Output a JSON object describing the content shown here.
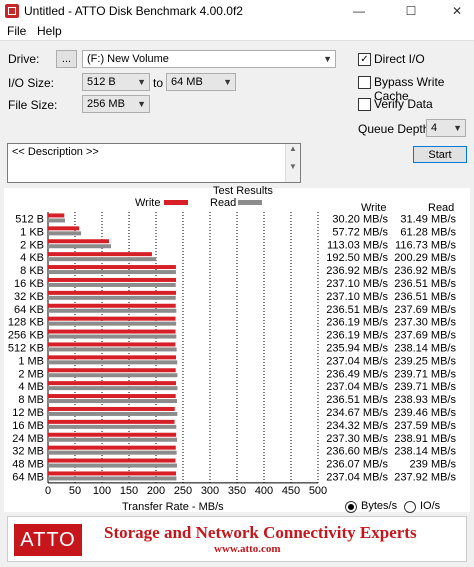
{
  "window": {
    "title": "Untitled - ATTO Disk Benchmark 4.00.0f2",
    "minimize": "—",
    "maximize": "☐",
    "close": "✕"
  },
  "menu": {
    "file": "File",
    "help": "Help"
  },
  "controls": {
    "drive_label": "Drive:",
    "browse_label": "...",
    "drive_value": "(F:) New Volume",
    "io_size_label": "I/O Size:",
    "io_from": "512 B",
    "to_label": "to",
    "io_to": "64 MB",
    "file_size_label": "File Size:",
    "file_size": "256 MB",
    "direct_io_label": "Direct I/O",
    "direct_io_checked": true,
    "bypass_label": "Bypass Write Cache",
    "bypass_checked": false,
    "verify_label": "Verify Data",
    "verify_checked": false,
    "queue_depth_label": "Queue Depth:",
    "queue_depth": "4",
    "start_label": "Start",
    "description": "<< Description >>"
  },
  "results": {
    "heading": "Test Results",
    "legend_write": "Write",
    "legend_read": "Read",
    "col_write": "Write",
    "col_read": "Read",
    "xlabel": "Transfer Rate - MB/s",
    "unit_bytes": "Bytes/s",
    "unit_io": "IO/s",
    "unit_selected": "Bytes/s"
  },
  "chart_data": {
    "type": "bar",
    "orientation": "horizontal",
    "title": "Test Results",
    "xlabel": "Transfer Rate - MB/s",
    "xlim": [
      0,
      500
    ],
    "xticks": [
      0,
      50,
      100,
      150,
      200,
      250,
      300,
      350,
      400,
      450,
      500
    ],
    "categories": [
      "512 B",
      "1 KB",
      "2 KB",
      "4 KB",
      "8 KB",
      "16 KB",
      "32 KB",
      "64 KB",
      "128 KB",
      "256 KB",
      "512 KB",
      "1 MB",
      "2 MB",
      "4 MB",
      "8 MB",
      "12 MB",
      "16 MB",
      "24 MB",
      "32 MB",
      "48 MB",
      "64 MB"
    ],
    "series": [
      {
        "name": "Write",
        "color": "#d61f26",
        "values": [
          30.2,
          57.72,
          113.03,
          192.5,
          236.92,
          237.1,
          237.1,
          236.51,
          236.19,
          236.19,
          235.94,
          237.04,
          236.49,
          237.04,
          236.51,
          234.67,
          234.32,
          237.3,
          236.6,
          236.07,
          237.04
        ],
        "labels": [
          "30.20 MB/s",
          "57.72 MB/s",
          "113.03 MB/s",
          "192.50 MB/s",
          "236.92 MB/s",
          "237.10 MB/s",
          "237.10 MB/s",
          "236.51 MB/s",
          "236.19 MB/s",
          "236.19 MB/s",
          "235.94 MB/s",
          "237.04 MB/s",
          "236.49 MB/s",
          "237.04 MB/s",
          "236.51 MB/s",
          "234.67 MB/s",
          "234.32 MB/s",
          "237.30 MB/s",
          "236.60 MB/s",
          "236.07 MB/s",
          "237.04 MB/s"
        ]
      },
      {
        "name": "Read",
        "color": "#8c8c8c",
        "values": [
          31.49,
          61.28,
          116.73,
          200.29,
          236.92,
          236.51,
          236.51,
          237.69,
          237.3,
          237.69,
          238.14,
          239.25,
          239.71,
          239.71,
          238.93,
          239.46,
          237.59,
          238.91,
          238.14,
          239,
          237.92
        ],
        "labels": [
          "31.49 MB/s",
          "61.28 MB/s",
          "116.73 MB/s",
          "200.29 MB/s",
          "236.92 MB/s",
          "236.51 MB/s",
          "236.51 MB/s",
          "237.69 MB/s",
          "237.30 MB/s",
          "237.69 MB/s",
          "238.14 MB/s",
          "239.25 MB/s",
          "239.71 MB/s",
          "239.71 MB/s",
          "238.93 MB/s",
          "239.46 MB/s",
          "237.59 MB/s",
          "238.91 MB/s",
          "238.14 MB/s",
          "239 MB/s",
          "237.92 MB/s"
        ]
      }
    ]
  },
  "banner": {
    "logo": "ATTO",
    "tagline": "Storage and Network Connectivity Experts",
    "url": "www.atto.com"
  }
}
